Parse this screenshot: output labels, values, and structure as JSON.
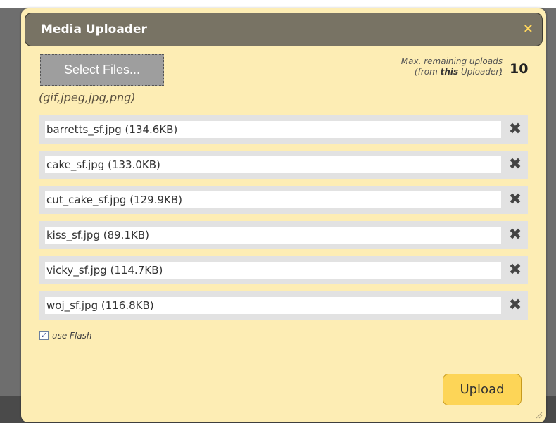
{
  "dialog": {
    "title": "Media Uploader",
    "close_icon": "close-icon",
    "accent_color": "#fdd557",
    "title_bar_color": "#787364",
    "background_color": "#fdedb4"
  },
  "select_button": {
    "label": "Select Files..."
  },
  "allowed_types": "(gif,jpeg,jpg,png)",
  "remaining": {
    "line1": "Max. remaining uploads",
    "line2_prefix": "(from ",
    "line2_bold": "this",
    "line2_suffix": " Uploader)",
    "separator": ":",
    "count": "10"
  },
  "files": [
    {
      "label": "barretts_sf.jpg (134.6KB)",
      "remove": "✖"
    },
    {
      "label": "cake_sf.jpg (133.0KB)",
      "remove": "✖"
    },
    {
      "label": "cut_cake_sf.jpg (129.9KB)",
      "remove": "✖"
    },
    {
      "label": "kiss_sf.jpg (89.1KB)",
      "remove": "✖"
    },
    {
      "label": "vicky_sf.jpg (114.7KB)",
      "remove": "✖"
    },
    {
      "label": "woj_sf.jpg (116.8KB)",
      "remove": "✖"
    }
  ],
  "use_flash": {
    "label": "use Flash",
    "checked": true,
    "check_glyph": "✓"
  },
  "upload_button": {
    "label": "Upload"
  },
  "close_glyph": "×"
}
